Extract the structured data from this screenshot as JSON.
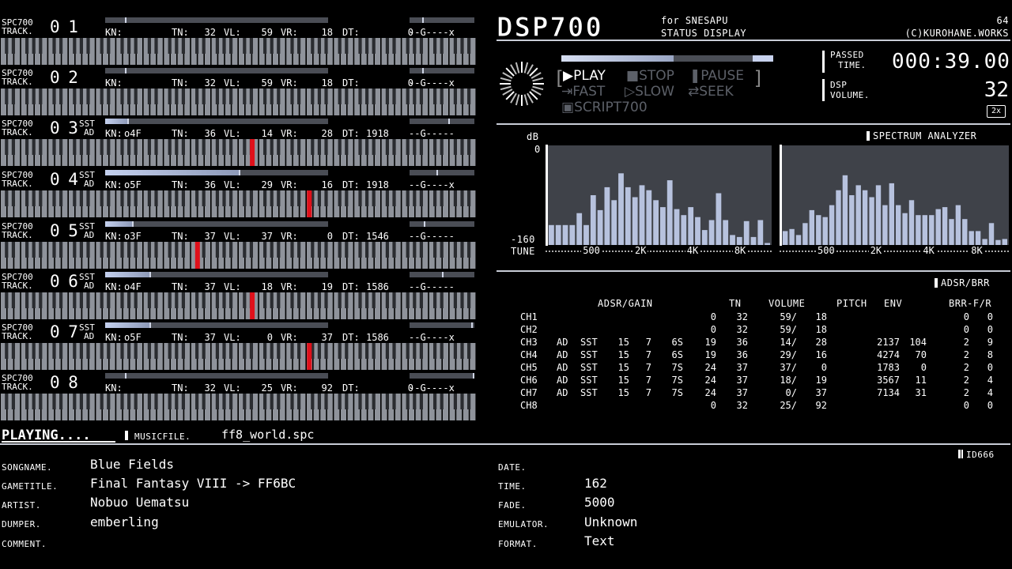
{
  "tracks": [
    {
      "label1": "SPC700",
      "label2": "TRACK.",
      "num": "0 1",
      "sst": "",
      "ad": "",
      "kn": "",
      "tn": "32",
      "vl": "59",
      "vr": "18",
      "dt": "0",
      "pan": "--G----x",
      "bar": 0.0,
      "bar_tick": 0.09,
      "pan_pos": 0.2,
      "note": null
    },
    {
      "label1": "SPC700",
      "label2": "TRACK.",
      "num": "0 2",
      "sst": "",
      "ad": "",
      "kn": "",
      "tn": "32",
      "vl": "59",
      "vr": "18",
      "dt": "0",
      "pan": "--G----x",
      "bar": 0.0,
      "bar_tick": 0.09,
      "pan_pos": 0.2,
      "note": null
    },
    {
      "label1": "SPC700",
      "label2": "TRACK.",
      "num": "0 3",
      "sst": "SST",
      "ad": "AD",
      "kn": "o4F",
      "tn": "36",
      "vl": "14",
      "vr": "28",
      "dt": "1918",
      "pan": "--G-----",
      "bar": 0.1,
      "bar_tick": 0.1,
      "pan_pos": 0.6,
      "note": 0.525
    },
    {
      "label1": "SPC700",
      "label2": "TRACK.",
      "num": "0 4",
      "sst": "SST",
      "ad": "AD",
      "kn": "o5F",
      "tn": "36",
      "vl": "29",
      "vr": "16",
      "dt": "1918",
      "pan": "--G----x",
      "bar": 0.6,
      "bar_tick": 0.6,
      "pan_pos": 0.42,
      "note": 0.645
    },
    {
      "label1": "SPC700",
      "label2": "TRACK.",
      "num": "0 5",
      "sst": "SST",
      "ad": "AD",
      "kn": "o3F",
      "tn": "37",
      "vl": "37",
      "vr": "0",
      "dt": "1546",
      "pan": "--G-----",
      "bar": 0.12,
      "bar_tick": 0.12,
      "pan_pos": 0.22,
      "note": 0.41
    },
    {
      "label1": "SPC700",
      "label2": "TRACK.",
      "num": "0 6",
      "sst": "SST",
      "ad": "AD",
      "kn": "o4F",
      "tn": "37",
      "vl": "18",
      "vr": "19",
      "dt": "1586",
      "pan": "--G-----",
      "bar": 0.2,
      "bar_tick": 0.2,
      "pan_pos": 0.5,
      "note": 0.525
    },
    {
      "label1": "SPC700",
      "label2": "TRACK.",
      "num": "0 7",
      "sst": "SST",
      "ad": "AD",
      "kn": "o5F",
      "tn": "37",
      "vl": "0",
      "vr": "37",
      "dt": "1586",
      "pan": "--G----x",
      "bar": 0.2,
      "bar_tick": 0.2,
      "pan_pos": 0.95,
      "note": 0.645
    },
    {
      "label1": "SPC700",
      "label2": "TRACK.",
      "num": "0 8",
      "sst": "",
      "ad": "",
      "kn": "",
      "tn": "32",
      "vl": "25",
      "vr": "92",
      "dt": "0",
      "pan": "--G----x",
      "bar": 0.0,
      "bar_tick": 0.09,
      "pan_pos": 0.98,
      "note": null
    }
  ],
  "track_labels": {
    "kn": "KN:",
    "tn": "TN:",
    "vl": "VL:",
    "vr": "VR:",
    "dt": "DT:"
  },
  "header": {
    "title": "DSP700",
    "for": "for SNESAPU",
    "status": "STATUS DISPLAY",
    "copyright": "(C)KUROHANE.WORKS",
    "num64": "64"
  },
  "controls": {
    "play": "PLAY",
    "stop": "STOP",
    "pause": "PAUSE",
    "fast": "FAST",
    "slow": "SLOW",
    "seek": "SEEK",
    "script": "SCRIPT700",
    "progress": 0.53
  },
  "passed": {
    "label1": "PASSED",
    "label2": "TIME.",
    "value": "000:39.00"
  },
  "volume": {
    "label1": "DSP",
    "label2": "VOLUME.",
    "value": "32",
    "mult": "2x"
  },
  "spectrum": {
    "title": "SPECTRUM ANALYZER",
    "db": "dB",
    "db_top": "0",
    "db_bot": "-160",
    "tune": "TUNE",
    "ticks": [
      "500",
      "2K",
      "4K",
      "8K"
    ],
    "left": [
      0.2,
      0.2,
      0.2,
      0.2,
      0.32,
      0.2,
      0.5,
      0.35,
      0.58,
      0.45,
      0.72,
      0.58,
      0.48,
      0.6,
      0.55,
      0.45,
      0.38,
      0.65,
      0.36,
      0.3,
      0.38,
      0.28,
      0.15,
      0.25,
      0.52,
      0.25,
      0.1,
      0.08,
      0.24,
      0.08,
      0.25,
      0.02
    ],
    "right": [
      0.14,
      0.16,
      0.1,
      0.22,
      0.35,
      0.3,
      0.28,
      0.4,
      0.55,
      0.7,
      0.5,
      0.6,
      0.55,
      0.48,
      0.6,
      0.4,
      0.62,
      0.4,
      0.32,
      0.45,
      0.3,
      0.3,
      0.3,
      0.36,
      0.38,
      0.26,
      0.4,
      0.26,
      0.14,
      0.14,
      0.06,
      0.22,
      0.05,
      0.06
    ]
  },
  "adsr": {
    "title": "ADSR/BRR",
    "headers": {
      "adsr_gain": "ADSR/GAIN",
      "tn": "TN",
      "volume": "VOLUME",
      "pitch": "PITCH",
      "env": "ENV",
      "brr": "BRR-F/R"
    },
    "rows": [
      {
        "ch": "CH1",
        "ad": "",
        "sst": "",
        "a": "",
        "b": "",
        "c": "",
        "d": "0",
        "tn": "32",
        "vol": "59/",
        "vol2": "18",
        "pitch": "",
        "env": "",
        "f": "0",
        "r": "0"
      },
      {
        "ch": "CH2",
        "ad": "",
        "sst": "",
        "a": "",
        "b": "",
        "c": "",
        "d": "0",
        "tn": "32",
        "vol": "59/",
        "vol2": "18",
        "pitch": "",
        "env": "",
        "f": "0",
        "r": "0"
      },
      {
        "ch": "CH3",
        "ad": "AD",
        "sst": "SST",
        "a": "15",
        "b": "7",
        "c": "6S",
        "d": "19",
        "tn": "36",
        "vol": "14/",
        "vol2": "28",
        "pitch": "2137",
        "env": "104",
        "f": "2",
        "r": "9"
      },
      {
        "ch": "CH4",
        "ad": "AD",
        "sst": "SST",
        "a": "15",
        "b": "7",
        "c": "6S",
        "d": "19",
        "tn": "36",
        "vol": "29/",
        "vol2": "16",
        "pitch": "4274",
        "env": "70",
        "f": "2",
        "r": "8"
      },
      {
        "ch": "CH5",
        "ad": "AD",
        "sst": "SST",
        "a": "15",
        "b": "7",
        "c": "7S",
        "d": "24",
        "tn": "37",
        "vol": "37/",
        "vol2": "0",
        "pitch": "1783",
        "env": "0",
        "f": "2",
        "r": "0"
      },
      {
        "ch": "CH6",
        "ad": "AD",
        "sst": "SST",
        "a": "15",
        "b": "7",
        "c": "7S",
        "d": "24",
        "tn": "37",
        "vol": "18/",
        "vol2": "19",
        "pitch": "3567",
        "env": "11",
        "f": "2",
        "r": "4"
      },
      {
        "ch": "CH7",
        "ad": "AD",
        "sst": "SST",
        "a": "15",
        "b": "7",
        "c": "7S",
        "d": "24",
        "tn": "37",
        "vol": "0/",
        "vol2": "37",
        "pitch": "7134",
        "env": "31",
        "f": "2",
        "r": "4"
      },
      {
        "ch": "CH8",
        "ad": "",
        "sst": "",
        "a": "",
        "b": "",
        "c": "",
        "d": "0",
        "tn": "32",
        "vol": "25/",
        "vol2": "92",
        "pitch": "",
        "env": "",
        "f": "0",
        "r": "0"
      }
    ]
  },
  "status_bar": {
    "playing": "PLAYING....",
    "musicfile_label": "MUSICFILE.",
    "musicfile": "ff8_world.spc",
    "id": "ID666"
  },
  "id666": {
    "songname_label": "SONGNAME.",
    "songname": "Blue Fields",
    "gametitle_label": "GAMETITLE.",
    "gametitle": "Final Fantasy VIII -> FF6BC",
    "artist_label": "ARTIST.",
    "artist": "Nobuo Uematsu",
    "dumper_label": "DUMPER.",
    "dumper": "emberling",
    "comment_label": "COMMENT.",
    "comment": "",
    "date_label": "DATE.",
    "date": "",
    "time_label": "TIME.",
    "time": "162",
    "fade_label": "FADE.",
    "fade": "5000",
    "emulator_label": "EMULATOR.",
    "emulator": "Unknown",
    "format_label": "FORMAT.",
    "format": "Text"
  },
  "colors": {
    "accent": "#c8d2ee",
    "note": "#e0101a",
    "bar_bg": "#4a4d55"
  }
}
